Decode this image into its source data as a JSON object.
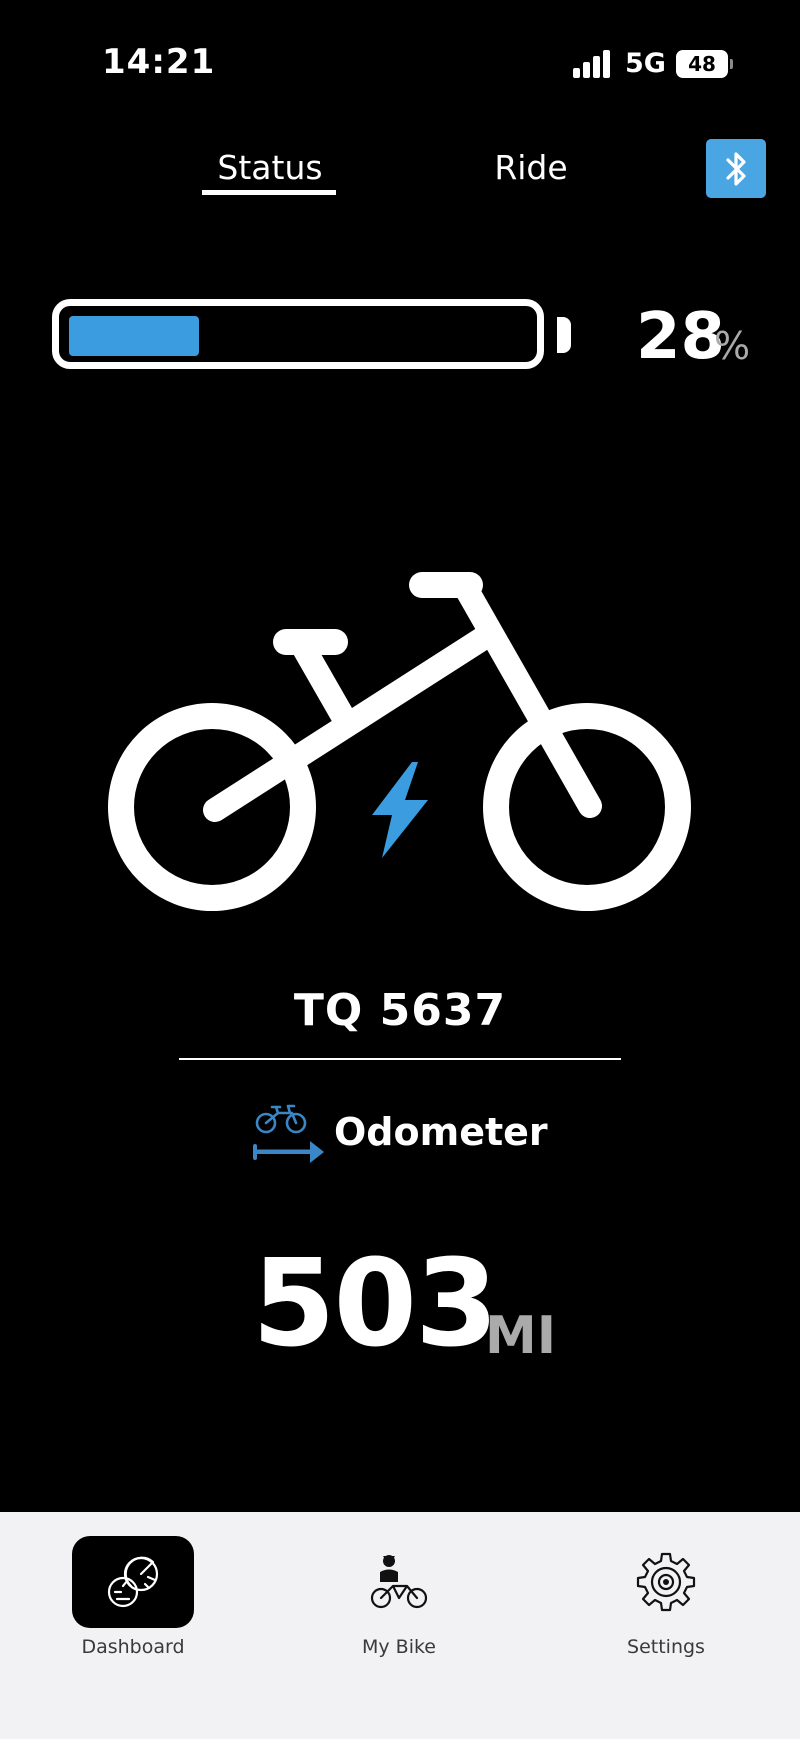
{
  "status_bar": {
    "time": "14:21",
    "network": "5G",
    "battery": "48"
  },
  "tabs": [
    {
      "label": "Status",
      "active": true
    },
    {
      "label": "Ride",
      "active": false
    }
  ],
  "bluetooth": {
    "icon": "bluetooth-icon",
    "color": "#4aa6e3"
  },
  "battery": {
    "percent": "28",
    "percent_sign": "%",
    "level": 0.28,
    "fill_color": "#3b9ddf"
  },
  "bike": {
    "name": "TQ 5637",
    "icon": "electric-bike-icon",
    "bolt_color": "#3b9ddf"
  },
  "odometer": {
    "label": "Odometer",
    "icon": "odometer-bike-icon",
    "value": "503",
    "unit": "MI"
  },
  "bottom_nav": [
    {
      "label": "Dashboard",
      "icon": "speedometer-icon",
      "active": true
    },
    {
      "label": "My Bike",
      "icon": "rider-bike-icon",
      "active": false
    },
    {
      "label": "Settings",
      "icon": "gear-icon",
      "active": false
    }
  ]
}
